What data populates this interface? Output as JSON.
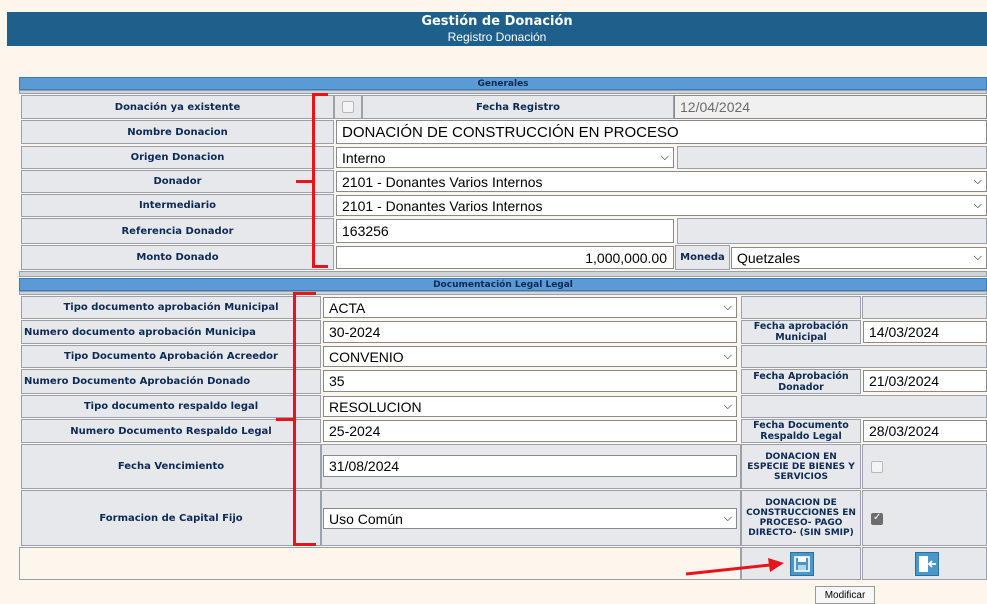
{
  "header": {
    "title": "Gestión de Donación",
    "subtitle": "Registro Donación"
  },
  "generales": {
    "section_title": "Generales",
    "donacion_existente_label": "Donación ya existente",
    "fecha_registro_label": "Fecha Registro",
    "fecha_registro_value": "12/04/2024",
    "nombre_label": "Nombre Donacion",
    "nombre_value": "DONACIÓN DE CONSTRUCCIÓN EN PROCESO",
    "origen_label": "Origen Donacion",
    "origen_value": "Interno",
    "donador_label": "Donador",
    "donador_value": "2101 - Donantes Varios Internos",
    "intermediario_label": "Intermediario",
    "intermediario_value": "2101 - Donantes Varios Internos",
    "referencia_label": "Referencia Donador",
    "referencia_value": "163256",
    "monto_label": "Monto Donado",
    "monto_value": "1,000,000.00",
    "moneda_label": "Moneda",
    "moneda_value": "Quetzales"
  },
  "legal": {
    "section_title": "Documentación Legal Legal",
    "tipo_mun_label": "Tipo documento aprobación Municipal",
    "tipo_mun_value": "ACTA",
    "num_mun_label": "Numero documento aprobación Municipa",
    "num_mun_value": "30-2024",
    "fecha_mun_label": "Fecha aprobación Municipal",
    "fecha_mun_value": "14/03/2024",
    "tipo_acr_label": "Tipo Documento Aprobación Acreedor",
    "tipo_acr_value": "CONVENIO",
    "num_don_label": "Numero Documento Aprobación Donado",
    "num_don_value": "35",
    "fecha_don_label": "Fecha Aprobación Donador",
    "fecha_don_value": "21/03/2024",
    "tipo_resp_label": "Tipo documento respaldo legal",
    "tipo_resp_value": "RESOLUCION",
    "num_resp_label": "Numero Documento Respaldo Legal",
    "num_resp_value": "25-2024",
    "fecha_resp_label": "Fecha Documento Respaldo Legal",
    "fecha_resp_value": "28/03/2024",
    "venc_label": "Fecha Vencimiento",
    "venc_value": "31/08/2024",
    "especie_label": "DONACION EN ESPECIE DE BIENES Y SERVICIOS",
    "capital_label": "Formacion de Capital Fijo",
    "capital_value": "Uso Común",
    "construcciones_label": "DONACION DE CONSTRUCCIONES EN PROCESO- PAGO DIRECTO- (SIN SMIP)"
  },
  "actions": {
    "tooltip": "Modificar",
    "save_icon": "floppy-disk-icon",
    "exit_icon": "exit-door-icon"
  },
  "colors": {
    "header": "#1f5f8b",
    "section": "#5b9bd5",
    "annotation": "#e8141b",
    "button": "#4a97c9"
  }
}
